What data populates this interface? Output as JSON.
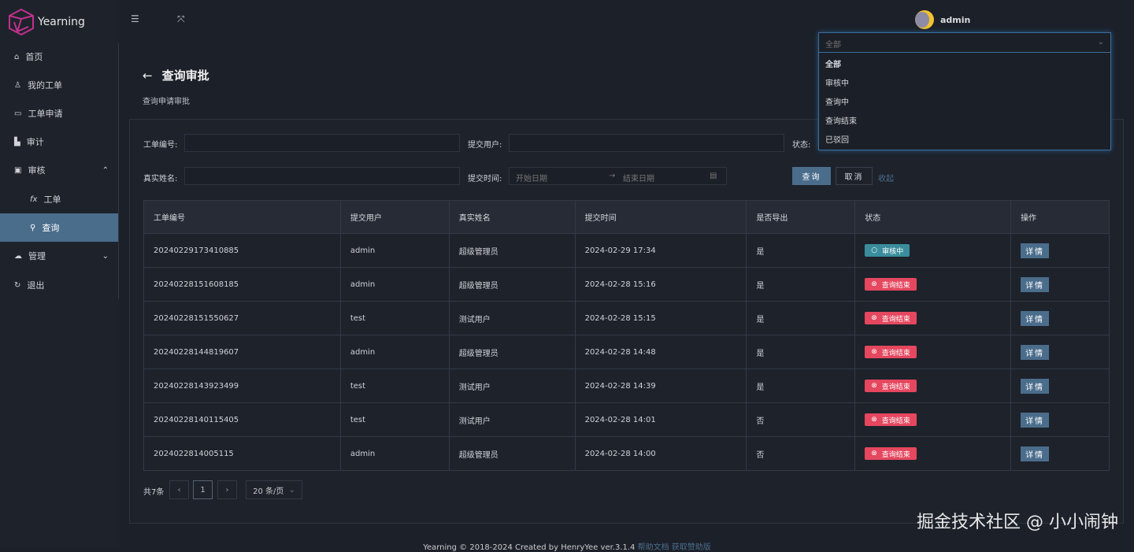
{
  "app": {
    "name": "Yearning"
  },
  "sidebar": {
    "items": [
      {
        "label": "首页",
        "icon": "home-icon"
      },
      {
        "label": "我的工单",
        "icon": "user-icon"
      },
      {
        "label": "工单申请",
        "icon": "monitor-icon"
      },
      {
        "label": "审计",
        "icon": "chart-icon"
      },
      {
        "label": "审核",
        "icon": "audit-icon"
      },
      {
        "label": "工单",
        "icon": "fx-icon"
      },
      {
        "label": "查询",
        "icon": "search-icon"
      },
      {
        "label": "管理",
        "icon": "cloud-icon"
      },
      {
        "label": "退出",
        "icon": "logout-icon"
      }
    ],
    "fx": "fx"
  },
  "header": {
    "user": "admin"
  },
  "page": {
    "title": "查询审批",
    "subtitle": "查询申请审批"
  },
  "filters": {
    "order_no": "工单编号:",
    "submitter": "提交用户:",
    "status": "状态:",
    "real_name": "真实姓名:",
    "submit_time": "提交时间:",
    "start_ph": "开始日期",
    "end_ph": "结束日期",
    "search": "查询",
    "cancel": "取消",
    "collapse": "收起"
  },
  "status_dropdown": {
    "selected": "全部",
    "options": [
      "全部",
      "审核中",
      "查询中",
      "查询结束",
      "已驳回"
    ]
  },
  "table": {
    "headers": [
      "工单编号",
      "提交用户",
      "真实姓名",
      "提交时间",
      "是否导出",
      "状态",
      "操作"
    ],
    "detail_label": "详情",
    "rows": [
      {
        "id": "20240229173410885",
        "user": "admin",
        "name": "超级管理员",
        "time": "2024-02-29 17:34",
        "export": "是",
        "status": "审核中",
        "kind": "w"
      },
      {
        "id": "20240228151608185",
        "user": "admin",
        "name": "超级管理员",
        "time": "2024-02-28 15:16",
        "export": "是",
        "status": "查询结束",
        "kind": "e"
      },
      {
        "id": "20240228151550627",
        "user": "test",
        "name": "测试用户",
        "time": "2024-02-28 15:15",
        "export": "是",
        "status": "查询结束",
        "kind": "e"
      },
      {
        "id": "20240228144819607",
        "user": "admin",
        "name": "超级管理员",
        "time": "2024-02-28 14:48",
        "export": "是",
        "status": "查询结束",
        "kind": "e"
      },
      {
        "id": "20240228143923499",
        "user": "test",
        "name": "测试用户",
        "time": "2024-02-28 14:39",
        "export": "是",
        "status": "查询结束",
        "kind": "e"
      },
      {
        "id": "20240228140115405",
        "user": "test",
        "name": "测试用户",
        "time": "2024-02-28 14:01",
        "export": "否",
        "status": "查询结束",
        "kind": "e"
      },
      {
        "id": "2024022814005115",
        "user": "admin",
        "name": "超级管理员",
        "time": "2024-02-28 14:00",
        "export": "否",
        "status": "查询结束",
        "kind": "e"
      }
    ]
  },
  "pagination": {
    "total": "共7条",
    "page": "1",
    "size": "20 条/页"
  },
  "footer": {
    "text": "Yearning © 2018-2024 Created by HenryYee ver.3.1.4",
    "help": "帮助文档",
    "sponsor": "获取赞助版"
  },
  "watermark": "掘金技术社区 @ 小小闹钟",
  "colors": {
    "accent": "#4b6d8c",
    "warn": "#3a8d9c",
    "error": "#e5475f"
  }
}
